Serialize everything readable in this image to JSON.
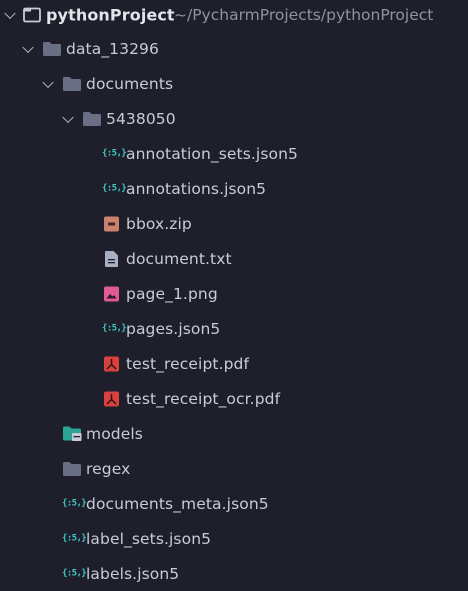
{
  "project": {
    "name": "pythonProject",
    "path": "~/PycharmProjects/pythonProject"
  },
  "tree": {
    "data_folder": "data_13296",
    "documents_folder": "documents",
    "doc_id_folder": "5438050",
    "files": {
      "annotation_sets": "annotation_sets.json5",
      "annotations": "annotations.json5",
      "bbox": "bbox.zip",
      "document": "document.txt",
      "page_1": "page_1.png",
      "pages": "pages.json5",
      "test_receipt": "test_receipt.pdf",
      "test_receipt_ocr": "test_receipt_ocr.pdf"
    },
    "models_folder": "models",
    "regex_folder": "regex",
    "documents_meta": "documents_meta.json5",
    "label_sets": "label_sets.json5",
    "labels": "labels.json5"
  },
  "icons": {
    "json5_glyph": "{:5,}",
    "folder": "folder-icon",
    "module_folder": "module-folder-icon",
    "json5": "json5-file-icon",
    "archive": "archive-icon",
    "text": "text-file-icon",
    "image": "image-file-icon",
    "pdf": "pdf-file-icon"
  },
  "colors": {
    "background": "#1e1f2b",
    "folder": "#6b6f86",
    "json5": "#3ec9c4",
    "archive": "#c9836d",
    "text_file": "#a8b0c4",
    "image": "#e05a94",
    "pdf": "#d9413f",
    "module_folder": "#2aa494"
  }
}
